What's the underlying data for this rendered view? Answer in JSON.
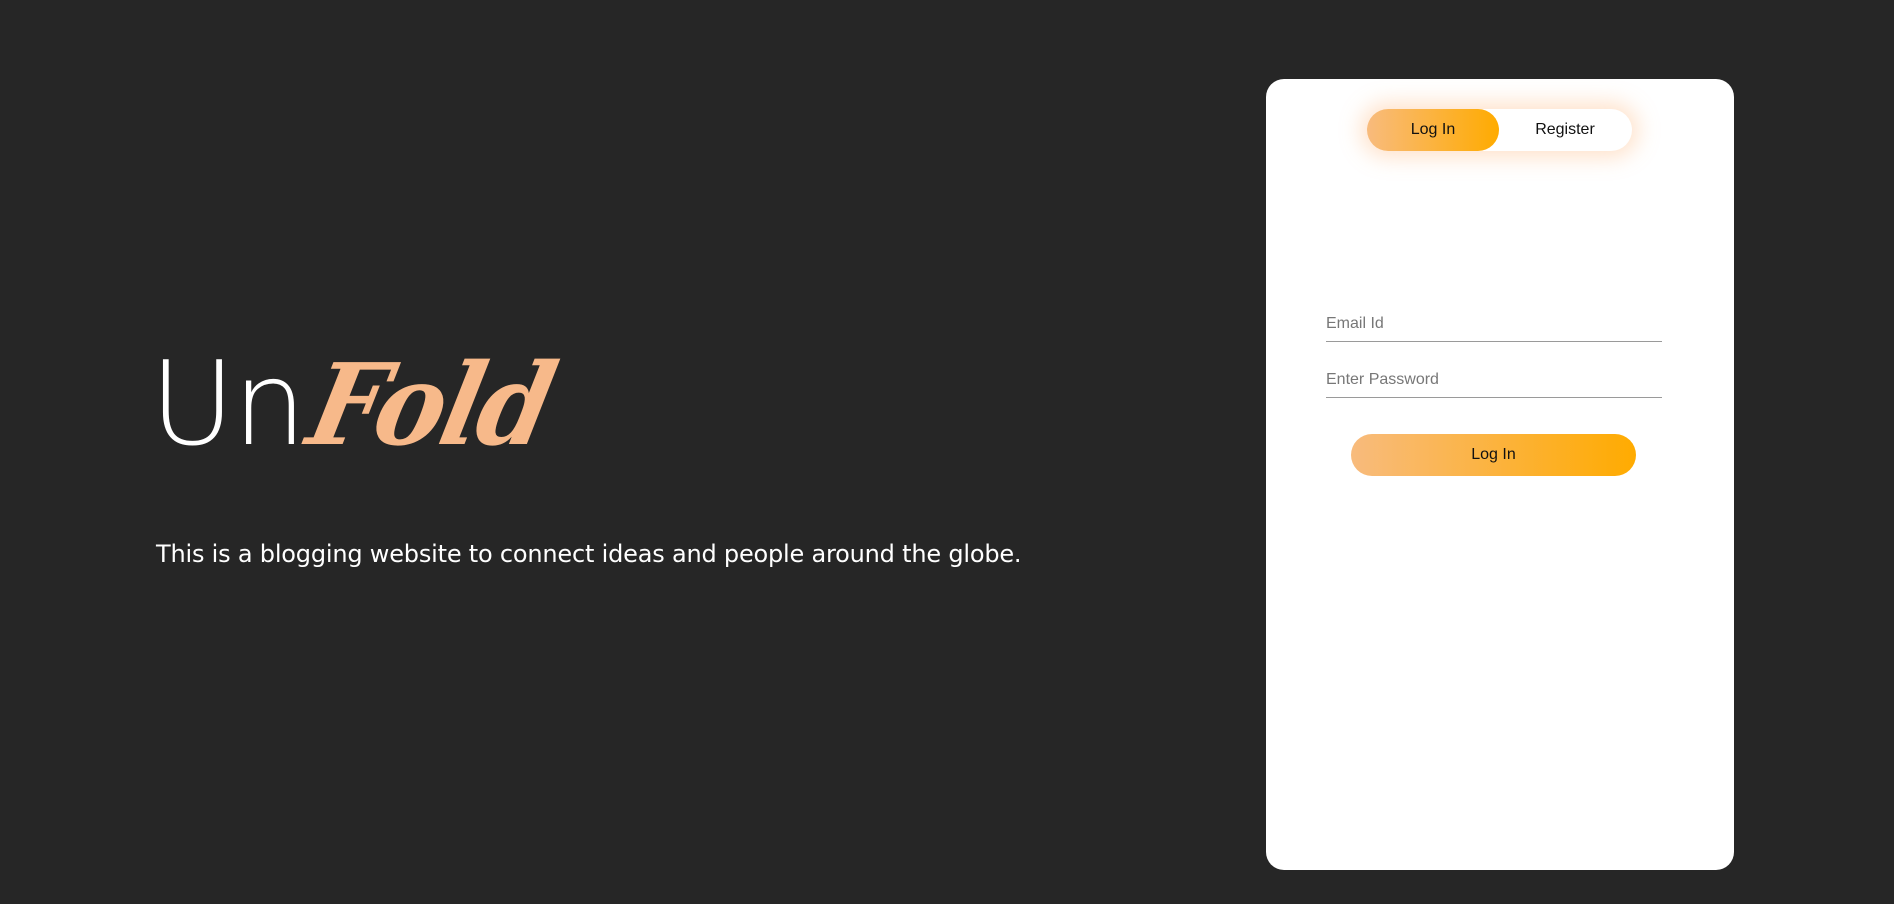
{
  "brand": {
    "part1": "Un",
    "part2": "Fold"
  },
  "tagline": "This is a blogging website to connect ideas and people around the globe.",
  "auth_toggle": {
    "login_label": "Log In",
    "register_label": "Register",
    "active": "Log In"
  },
  "login_form": {
    "email_placeholder": "Email Id",
    "password_placeholder": "Enter Password",
    "submit_label": "Log In"
  },
  "colors": {
    "background": "#262626",
    "card": "#ffffff",
    "accent_start": "#f8bb7d",
    "accent_end": "#ffab00",
    "brand_script": "#f7b98a"
  }
}
